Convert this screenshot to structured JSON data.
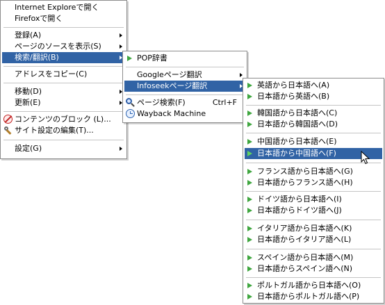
{
  "menu1": {
    "items": [
      {
        "label": "Internet Exploreで開く"
      },
      {
        "label": "Firefoxで開く"
      },
      {
        "label": "登録(A)"
      },
      {
        "label": "ページのソースを表示(S)"
      },
      {
        "label": "検索/翻訳(B)"
      },
      {
        "label": "アドレスをコピー(C)"
      },
      {
        "label": "移動(D)"
      },
      {
        "label": "更新(E)"
      },
      {
        "label": "コンテンツのブロック (L)..."
      },
      {
        "label": "サイト設定の編集(T)..."
      },
      {
        "label": "設定(G)"
      }
    ]
  },
  "menu2": {
    "items": [
      {
        "label": "POP辞書"
      },
      {
        "label": "Googleページ翻訳"
      },
      {
        "label": "Infoseekページ翻訳"
      },
      {
        "label": "ページ検索(F)",
        "shortcut": "Ctrl+F"
      },
      {
        "label": "Wayback Machine"
      }
    ]
  },
  "menu3": {
    "items": [
      {
        "label": "英語から日本語へ(A)"
      },
      {
        "label": "日本語から英語へ(B)"
      },
      {
        "label": "韓国語から日本語へ(C)"
      },
      {
        "label": "日本語から韓国語へ(D)"
      },
      {
        "label": "中国語から日本語へ(E)"
      },
      {
        "label": "日本語から中国語へ(F)"
      },
      {
        "label": "フランス語から日本語へ(G)"
      },
      {
        "label": "日本語からフランス語へ(H)"
      },
      {
        "label": "ドイツ語から日本語へ(I)"
      },
      {
        "label": "日本語からドイツ語へ(J)"
      },
      {
        "label": "イタリア語から日本語へ(K)"
      },
      {
        "label": "日本語からイタリア語へ(L)"
      },
      {
        "label": "スペイン語から日本語へ(M)"
      },
      {
        "label": "日本語からスペイン語へ(N)"
      },
      {
        "label": "ポルトガル語から日本語へ(O)"
      },
      {
        "label": "日本語からポルトガル語へ(P)"
      }
    ]
  },
  "colors": {
    "highlight": "#3163a5",
    "play_icon": "#3fa63f"
  },
  "icons": [
    "block-icon",
    "wrench-icon",
    "play-icon",
    "search-icon",
    "clock-icon",
    "submenu-arrow-icon",
    "mouse-cursor-icon"
  ]
}
